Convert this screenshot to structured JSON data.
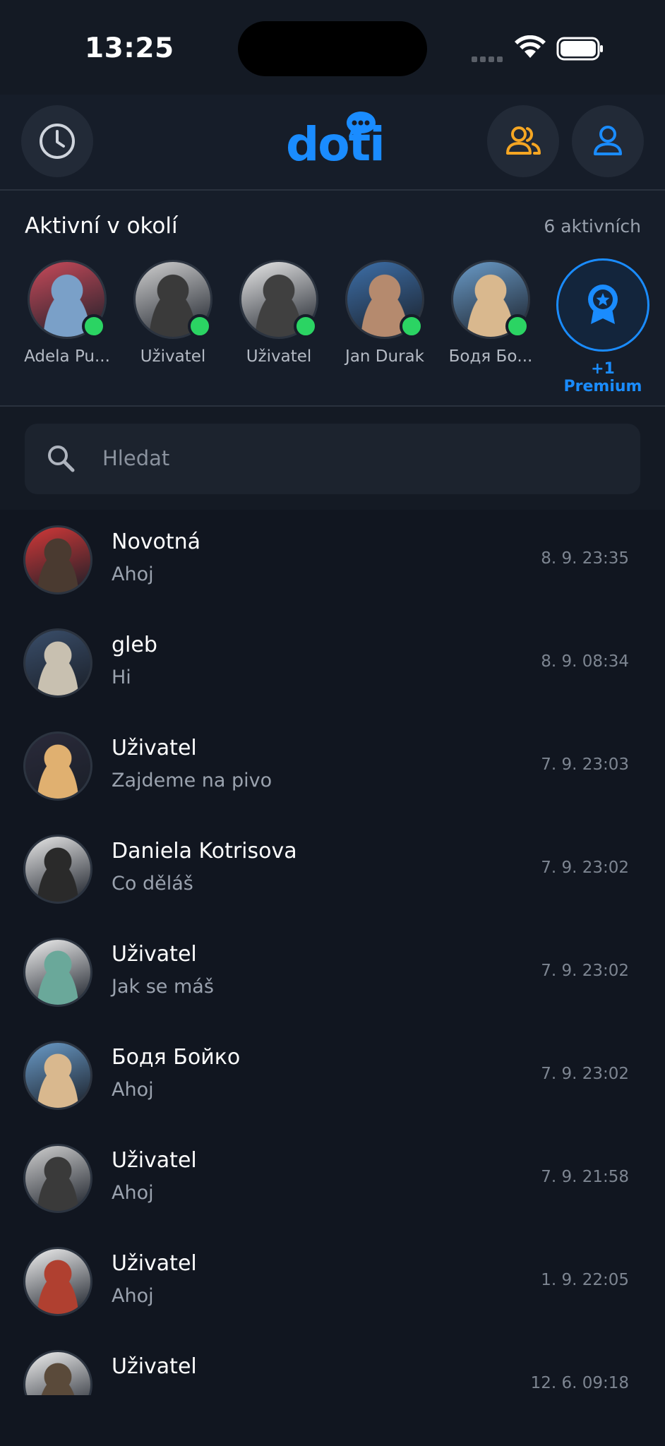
{
  "status_bar": {
    "time": "13:25"
  },
  "header": {
    "logo_text": "doti",
    "history_icon": "clock-icon",
    "friends_icon": "users-icon",
    "profile_icon": "user-icon",
    "colors": {
      "brand": "#1a8cff",
      "friends": "#f5a623"
    }
  },
  "active": {
    "title": "Aktivní v okolí",
    "count": "6 aktivních",
    "users": [
      {
        "name": "Adela Pu...",
        "colors": [
          "#c84a5a",
          "#7aa0c8"
        ]
      },
      {
        "name": "Uživatel",
        "colors": [
          "#d0d0d0",
          "#3a3a3a"
        ]
      },
      {
        "name": "Uživatel",
        "colors": [
          "#e8e8e8",
          "#404040"
        ]
      },
      {
        "name": "Jan Durak",
        "colors": [
          "#3d6fa8",
          "#b58a6e"
        ]
      },
      {
        "name": "Бодя Бо...",
        "colors": [
          "#6a9bc8",
          "#d9b88e"
        ]
      }
    ],
    "premium_label": "+1 Premium",
    "premium_icon": "award-icon"
  },
  "search": {
    "placeholder": "Hledat"
  },
  "chats": [
    {
      "name": "Novotná",
      "message": "Ahoj",
      "time": "8. 9. 23:35",
      "colors": [
        "#d23838",
        "#4a3a30"
      ]
    },
    {
      "name": "gleb",
      "message": "Hi",
      "time": "8. 9. 08:34",
      "colors": [
        "#3a4e6a",
        "#c8c0b0"
      ]
    },
    {
      "name": "Uživatel",
      "message": "Zajdeme na pivo",
      "time": "7. 9. 23:03",
      "colors": [
        "#2a2a3a",
        "#e0b070"
      ]
    },
    {
      "name": "Daniela Kotrisova",
      "message": "Co děláš",
      "time": "7. 9. 23:02",
      "colors": [
        "#e8e8e8",
        "#2a2a2a"
      ]
    },
    {
      "name": "Uživatel",
      "message": "Jak se máš",
      "time": "7. 9. 23:02",
      "colors": [
        "#f0f0f0",
        "#6aa89a"
      ]
    },
    {
      "name": "Бодя Бойко",
      "message": "Ahoj",
      "time": "7. 9. 23:02",
      "colors": [
        "#6a9bc8",
        "#d9b88e"
      ]
    },
    {
      "name": "Uživatel",
      "message": "Ahoj",
      "time": "7. 9. 21:58",
      "colors": [
        "#d0d0d0",
        "#3a3a3a"
      ]
    },
    {
      "name": "Uživatel",
      "message": "Ahoj",
      "time": "1. 9. 22:05",
      "colors": [
        "#f0f0f0",
        "#b04030"
      ]
    },
    {
      "name": "Uživatel",
      "message": "",
      "time": "12. 6. 09:18",
      "colors": [
        "#f0f0f0",
        "#5a4a3a"
      ]
    }
  ]
}
